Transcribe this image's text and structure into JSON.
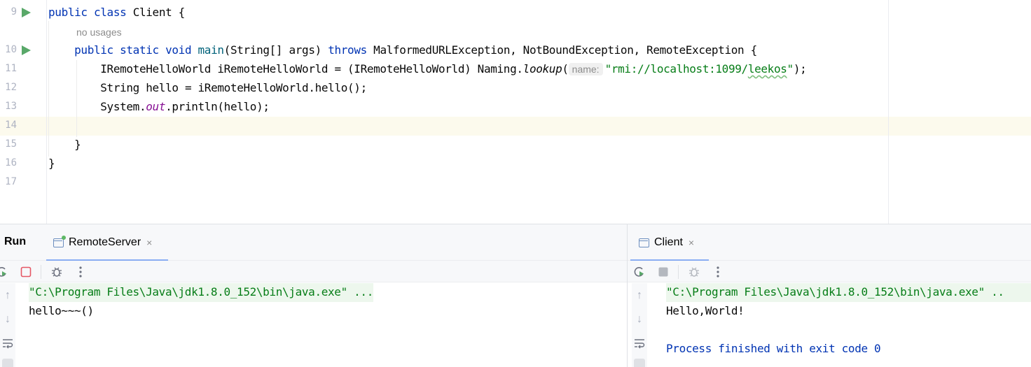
{
  "editor": {
    "no_usages": "no usages",
    "lines": [
      {
        "num": "9"
      },
      {
        "num": "10"
      },
      {
        "num": "11"
      },
      {
        "num": "12"
      },
      {
        "num": "13"
      },
      {
        "num": "14"
      },
      {
        "num": "15"
      },
      {
        "num": "16"
      },
      {
        "num": "17"
      }
    ],
    "code": {
      "l9_kw": "public class ",
      "l9_rest": "Client {",
      "l10_kw1": "    public static void ",
      "l10_fn": "main",
      "l10_a": "(String[] args) ",
      "l10_kw2": "throws ",
      "l10_b": "MalformedURLException, NotBoundException, RemoteException {",
      "l11_a": "        IRemoteHelloWorld iRemoteHelloWorld = (IRemoteHelloWorld) Naming.",
      "l11_lookup": "lookup",
      "l11_paren": "(",
      "l11_hint": "name:",
      "l11_str_a": "\"rmi://localhost:1099/",
      "l11_str_typo": "leekos",
      "l11_str_b": "\"",
      "l11_end": ");",
      "l12": "        String hello = iRemoteHelloWorld.hello();",
      "l13_a": "        System.",
      "l13_field": "out",
      "l13_b": ".println(hello);",
      "l15": "    }",
      "l16": "}"
    }
  },
  "toolwindow": {
    "title": "Run",
    "tabs": [
      {
        "label": "RemoteServer",
        "close": "×"
      },
      {
        "label": "Client",
        "close": "×"
      }
    ],
    "left_console": {
      "cmd": "\"C:\\Program Files\\Java\\jdk1.8.0_152\\bin\\java.exe\" ...",
      "output": "hello~~~()"
    },
    "right_console": {
      "cmd": "\"C:\\Program Files\\Java\\jdk1.8.0_152\\bin\\java.exe\" ..",
      "output": "Hello,World!",
      "exit": "Process finished with exit code 0"
    }
  },
  "colors": {
    "keyword": "#0033b3",
    "function": "#00627a",
    "string": "#067d17",
    "field": "#871094",
    "run_green": "#59a869",
    "stop_red": "#e55765",
    "tab_accent": "#3574f0"
  }
}
